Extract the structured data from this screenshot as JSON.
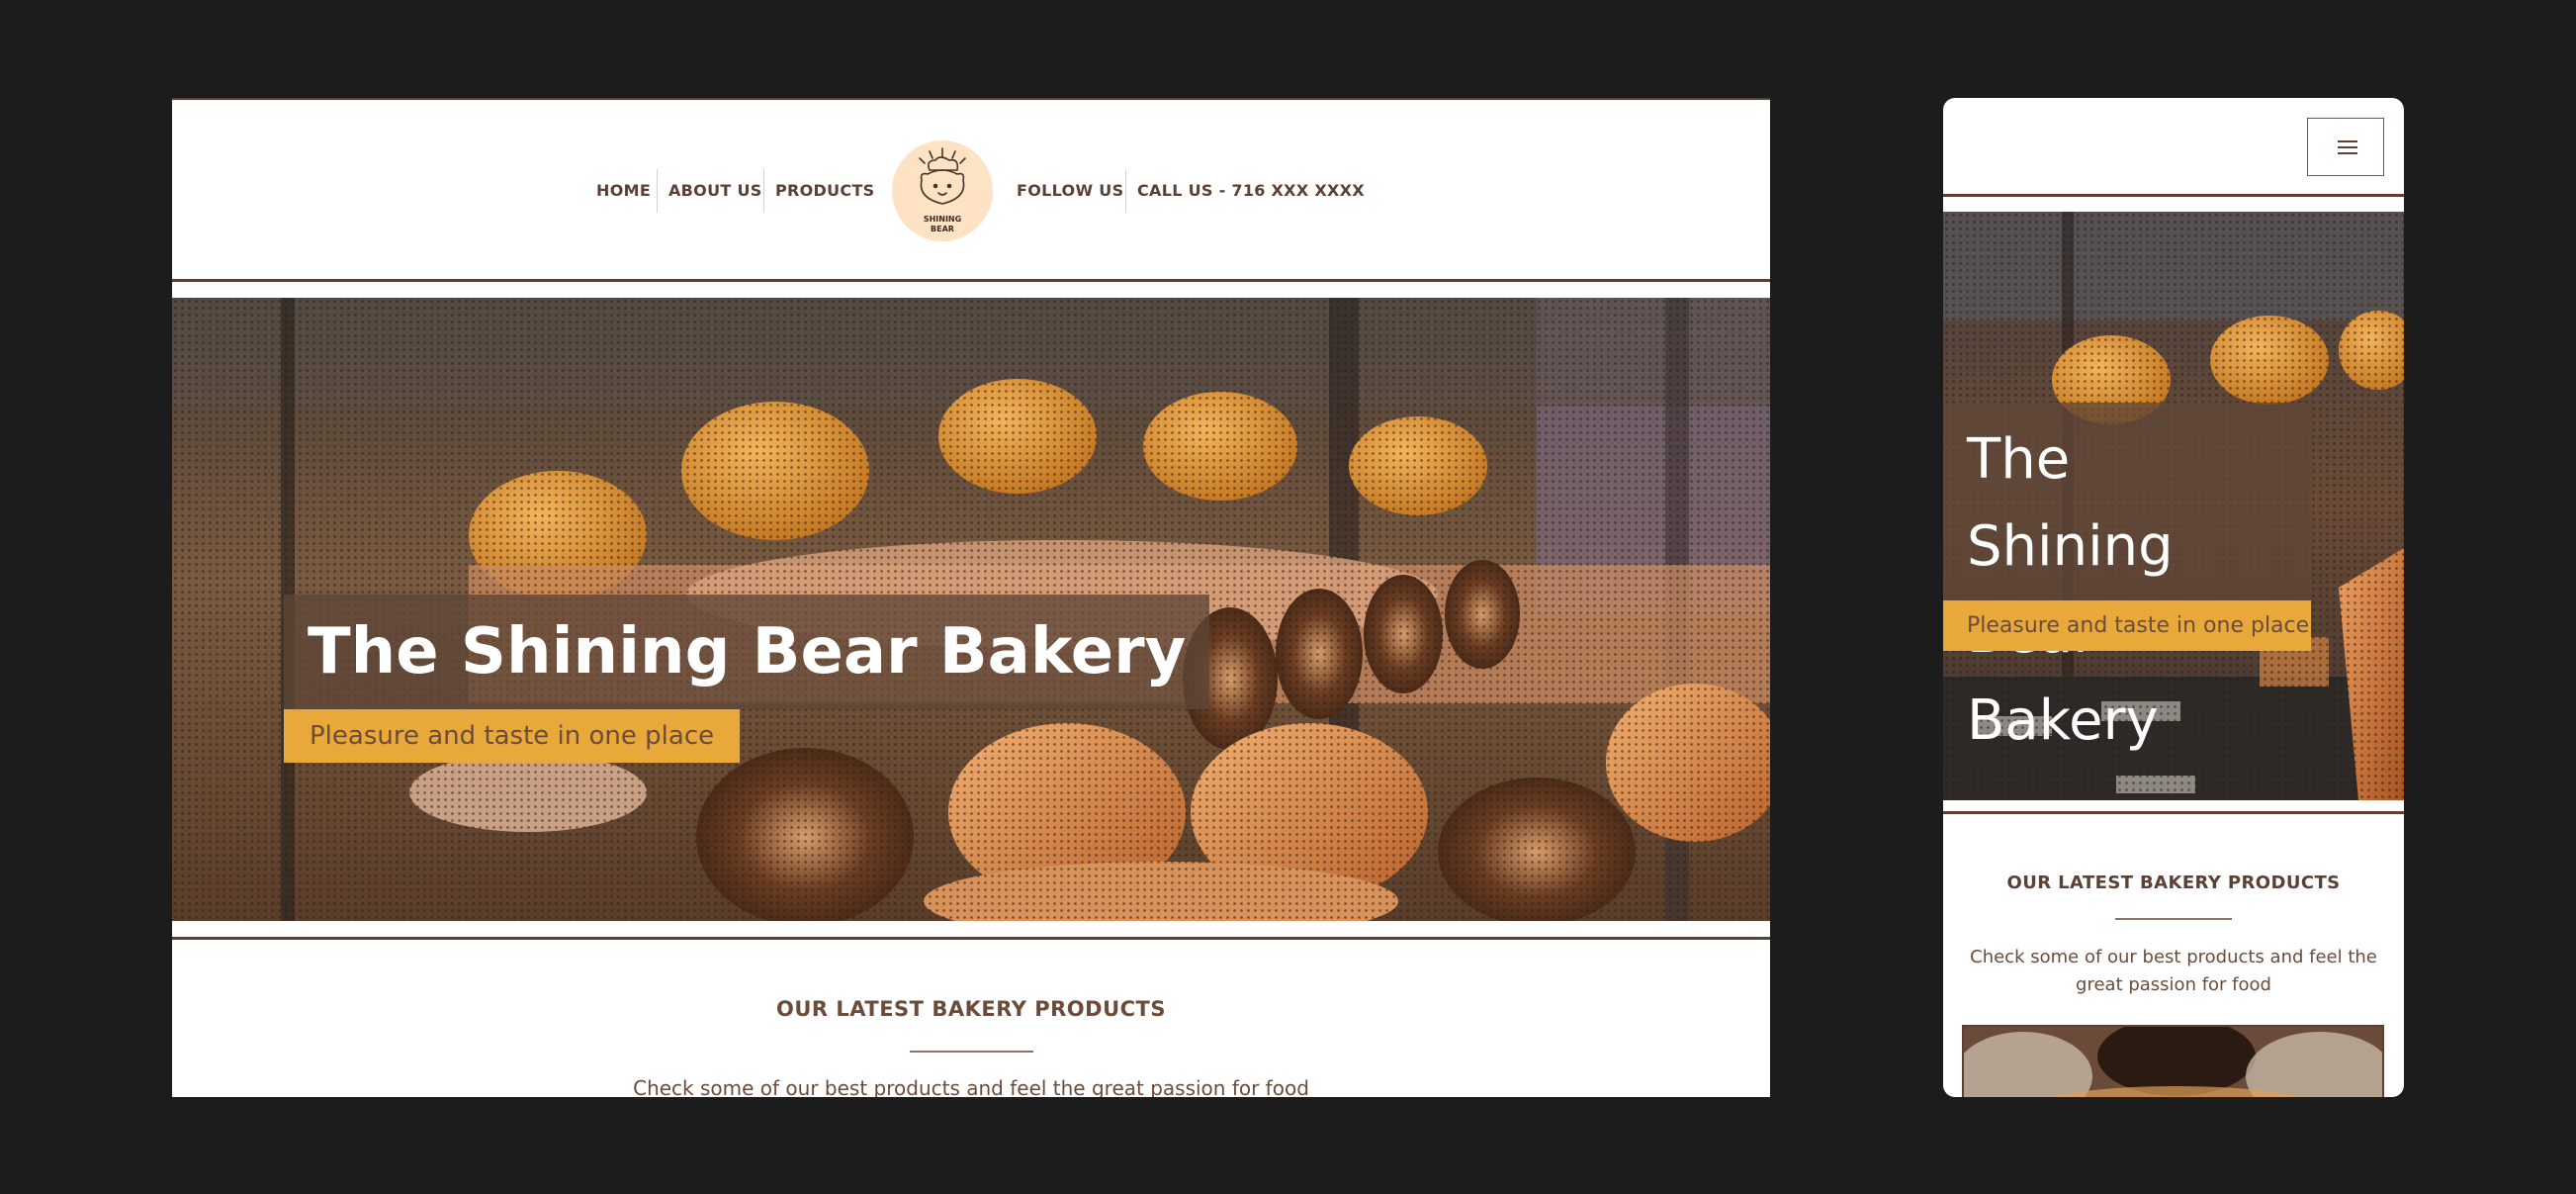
{
  "desktop": {
    "nav": {
      "home": "HOME",
      "about": "ABOUT US",
      "products": "PRODUCTS",
      "follow": "FOLLOW US",
      "call": "CALL US - 716 XXX XXXX"
    },
    "logo": {
      "line1": "SHINING",
      "line2": "BEAR"
    },
    "hero": {
      "title": "The Shining Bear Bakery",
      "subtitle": "Pleasure and taste in one place"
    },
    "section": {
      "title": "OUR LATEST BAKERY PRODUCTS",
      "description": "Check some of our best products and feel the great passion for food"
    }
  },
  "mobile": {
    "hero": {
      "title_line1": "The Shining",
      "title_line2": "Bear Bakery",
      "subtitle": "Pleasure and taste in one place"
    },
    "section": {
      "title": "OUR LATEST BAKERY PRODUCTS",
      "desc_line1": "Check some of our best products and feel the",
      "desc_line2": "great passion for food"
    }
  },
  "colors": {
    "brand_brown": "#5c4033",
    "accent_amber": "#e8a93a",
    "background": "#1c1c1c",
    "logo_bg": "#fde2c4"
  }
}
